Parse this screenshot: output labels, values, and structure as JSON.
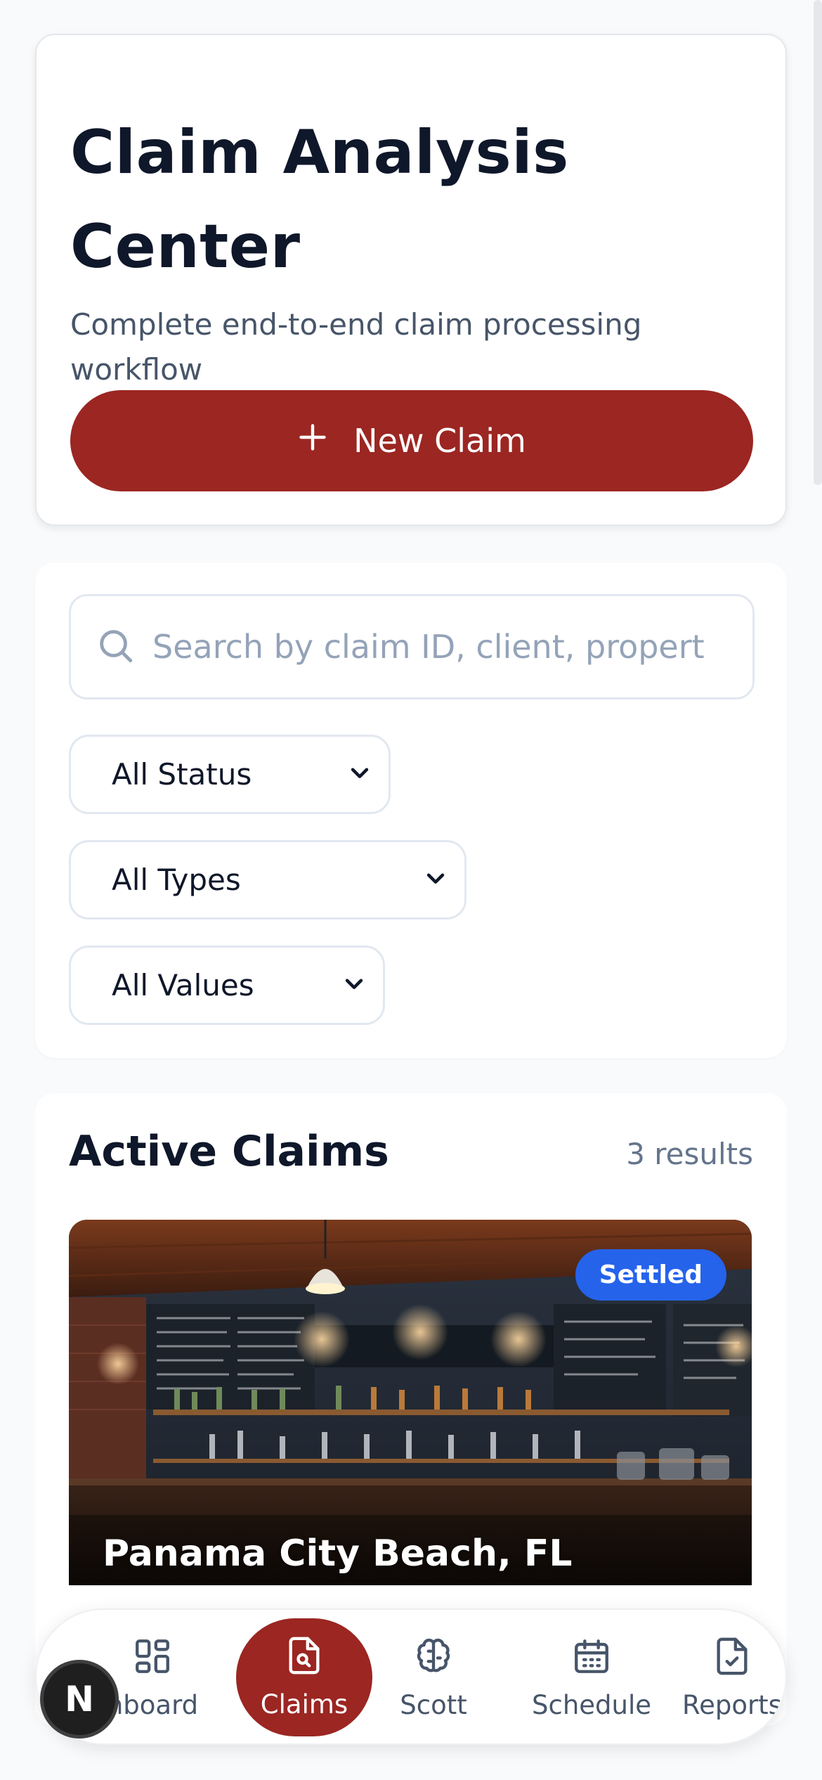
{
  "hero": {
    "title": "Claim Analysis Center",
    "subtitle": "Complete end-to-end claim processing workflow",
    "new_claim_label": "New Claim"
  },
  "filters": {
    "search_placeholder": "Search by claim ID, client, propert",
    "status_selected": "All Status",
    "type_selected": "All Types",
    "value_selected": "All Values"
  },
  "active_claims": {
    "title": "Active Claims",
    "count_text": "3 results",
    "claims": [
      {
        "status": "Settled",
        "location": "Panama City Beach, FL",
        "status_color": "#2563eb"
      }
    ]
  },
  "nav": {
    "items": [
      {
        "label": "hboard",
        "icon": "dashboard-grid-icon"
      },
      {
        "label": "Claims",
        "icon": "file-search-icon",
        "active": true
      },
      {
        "label": "Scott",
        "icon": "brain-icon"
      },
      {
        "label": "Schedule",
        "icon": "calendar-icon"
      },
      {
        "label": "Reports",
        "icon": "file-check-icon"
      }
    ]
  },
  "avatar": {
    "initial": "N"
  },
  "colors": {
    "brand": "#9b2622",
    "settled_badge": "#2563eb",
    "text_dark": "#0f172a",
    "muted": "#475569"
  }
}
